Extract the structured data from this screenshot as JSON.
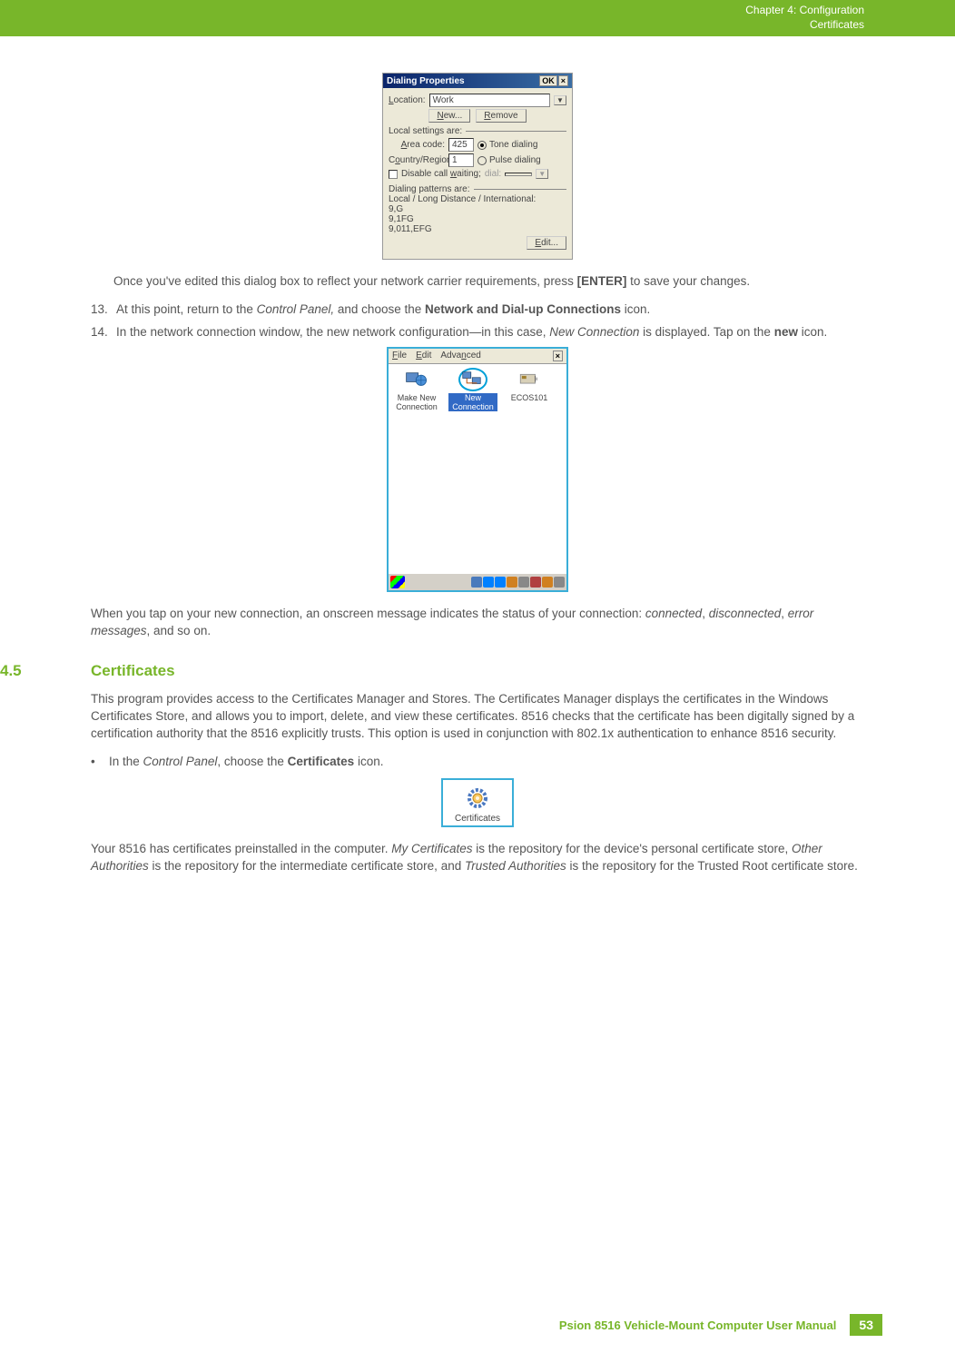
{
  "header": {
    "chapter": "Chapter 4:  Configuration",
    "section": "Certificates"
  },
  "dialog1": {
    "title": "Dialing Properties",
    "ok": "OK",
    "close": "×",
    "location_label": "Location:",
    "location_value": "Work",
    "new_btn": "New...",
    "remove_btn": "Remove",
    "local_settings_legend": "Local settings are:",
    "area_code_label": "Area code:",
    "area_code_value": "425",
    "tone_label": "Tone dialing",
    "country_label": "Country/Region:",
    "country_value": "1",
    "pulse_label": "Pulse dialing",
    "disable_cw": "Disable call waiting;",
    "dial_label": "dial:",
    "patterns_legend": "Dialing patterns are:",
    "patterns_desc": "Local / Long Distance / International:",
    "pat1": "9,G",
    "pat2": "9,1FG",
    "pat3": "9,011,EFG",
    "edit_btn": "Edit..."
  },
  "para1": {
    "pre": "Once you've edited this dialog box to reflect your network carrier requirements, press ",
    "key": "[ENTER]",
    "post": " to save your changes."
  },
  "step13": {
    "num": "13.",
    "pre": "At this point, return to the ",
    "cp": "Control Panel,",
    "mid": " and choose the ",
    "bold": "Network and Dial-up Connections",
    "post": " icon."
  },
  "step14": {
    "num": "14.",
    "pre": "In the network connection window, the new network configuration—in this case, ",
    "nc": "New Connection",
    "mid": " is displayed. Tap on the ",
    "bold": "new",
    "post": " icon."
  },
  "dialog2": {
    "file": "File",
    "edit": "Edit",
    "advanced": "Advanced",
    "close": "×",
    "make_new": "Make New Connection",
    "new_conn": "New Connection",
    "ecos": "ECOS101"
  },
  "para2": {
    "pre": "When you tap on your new connection, an onscreen message indicates the status of your connection: ",
    "i1": "connected",
    "s1": ", ",
    "i2": "disconnected",
    "s2": ", ",
    "i3": "error messages",
    "post": ", and so on."
  },
  "section45": {
    "num": "4.5",
    "title": "Certificates"
  },
  "cert_para1": "This program provides access to the Certificates Manager and Stores. The Certificates Manager displays the certificates in the Windows Certificates Store, and allows you to import, delete, and view these certificates. 8516 checks that the certificate has been digitally signed by a certification authority that the 8516 explicitly trusts. This option is used in conjunction with 802.1x authentication to enhance 8516 security.",
  "cert_bullet": {
    "pre": "In the ",
    "cp": "Control Panel",
    "mid": ", choose the ",
    "bold": "Certificates",
    "post": " icon."
  },
  "cert_icon_label": "Certificates",
  "cert_para2": {
    "pre": "Your 8516 has certificates preinstalled in the computer. ",
    "i1": "My Certificates",
    "mid1": " is the repository for the device's personal certificate store, ",
    "i2": "Other Authorities",
    "mid2": " is the repository for the intermediate certificate store, and ",
    "i3": "Trusted Authorities",
    "post": " is the repository for the Trusted Root certificate store."
  },
  "footer": {
    "text": "Psion 8516 Vehicle-Mount Computer User Manual",
    "page": "53"
  }
}
